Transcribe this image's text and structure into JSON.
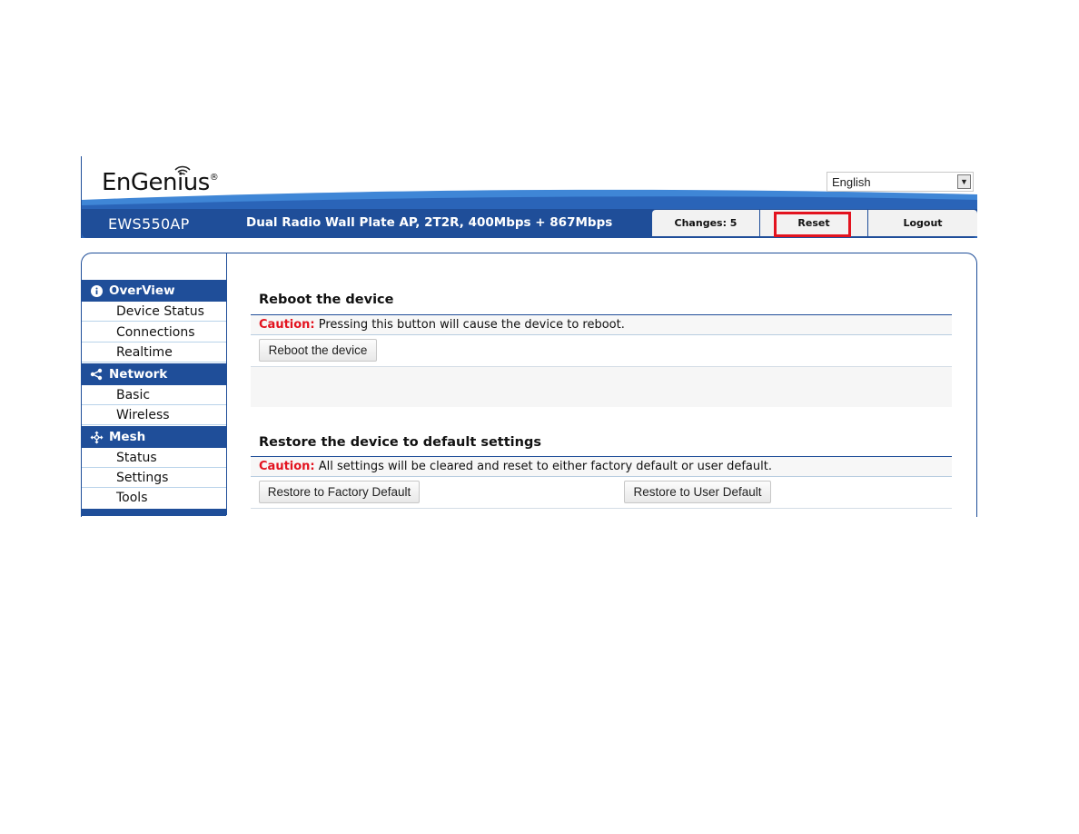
{
  "header": {
    "logo_text": "EnGenius",
    "logo_reg": "®",
    "language": {
      "selected": "English"
    },
    "model": "EWS550AP",
    "description": "Dual Radio Wall Plate AP, 2T2R, 400Mbps + 867Mbps",
    "tabs": [
      {
        "label": "Changes: 5"
      },
      {
        "label": "Reset",
        "highlighted": true
      },
      {
        "label": "Logout"
      }
    ]
  },
  "sidebar": {
    "groups": [
      {
        "label": "OverView",
        "icon": "info-icon",
        "items": [
          "Device Status",
          "Connections",
          "Realtime"
        ]
      },
      {
        "label": "Network",
        "icon": "share-icon",
        "items": [
          "Basic",
          "Wireless"
        ]
      },
      {
        "label": "Mesh",
        "icon": "move-arrows-icon",
        "items": [
          "Status",
          "Settings",
          "Tools"
        ]
      }
    ]
  },
  "main": {
    "reboot": {
      "title": "Reboot the device",
      "caution_label": "Caution:",
      "caution_text": " Pressing this button will cause the device to reboot.",
      "button": "Reboot the device"
    },
    "restore": {
      "title": "Restore the device to default settings",
      "caution_label": "Caution:",
      "caution_text": " All settings will be cleared and reset to either factory default or user default.",
      "factory_button": "Restore to Factory Default",
      "user_button": "Restore to User Default"
    }
  },
  "colors": {
    "brand_blue": "#1f4e99",
    "caution_red": "#e3131f",
    "highlight_red": "#e3131f"
  }
}
